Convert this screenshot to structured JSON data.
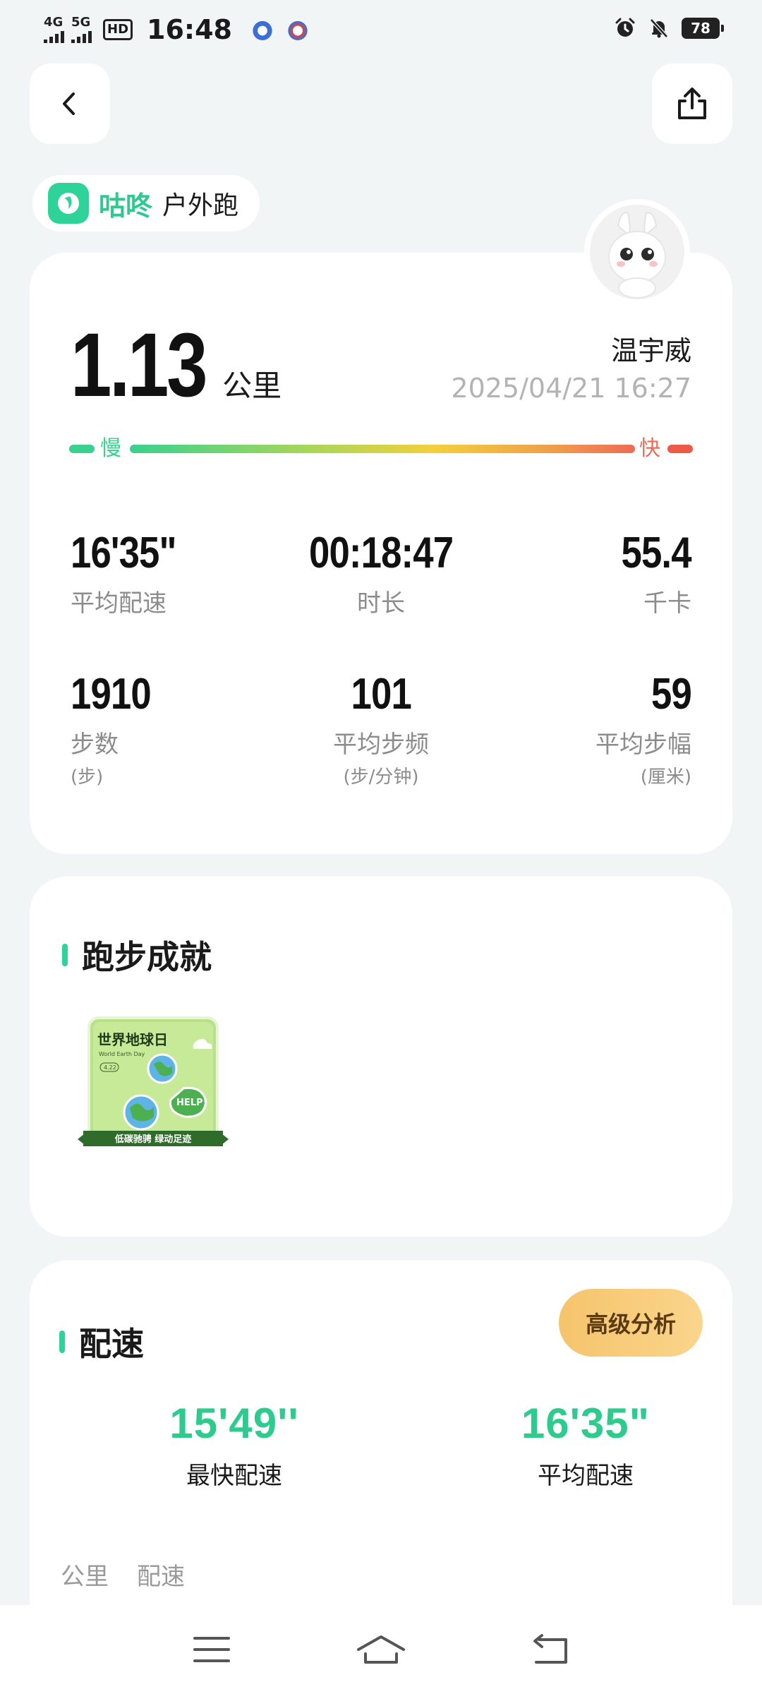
{
  "status_bar": {
    "network_1": "4G",
    "network_2": "5G",
    "hd_label": "HD",
    "time": "16:48",
    "battery": "78"
  },
  "header": {
    "back_icon": "chevron-left-icon",
    "share_icon": "share-icon"
  },
  "app_tag": {
    "brand": "咕咚",
    "sport": "户外跑"
  },
  "summary": {
    "distance": "1.13",
    "distance_unit": "公里",
    "user_name": "温宇威",
    "datetime": "2025/04/21 16:27",
    "speed_scale": {
      "slow": "慢",
      "fast": "快"
    },
    "stats": [
      {
        "value": "16'35\"",
        "label": "平均配速",
        "unit": ""
      },
      {
        "value": "00:18:47",
        "label": "时长",
        "unit": ""
      },
      {
        "value": "55.4",
        "label": "千卡",
        "unit": ""
      },
      {
        "value": "1910",
        "label": "步数",
        "unit": "(步)"
      },
      {
        "value": "101",
        "label": "平均步频",
        "unit": "(步/分钟)"
      },
      {
        "value": "59",
        "label": "平均步幅",
        "unit": "(厘米)"
      }
    ]
  },
  "achievements": {
    "title": "跑步成就",
    "badge": {
      "title": "世界地球日",
      "subtitle": "World Earth Day",
      "date": "4.22",
      "ribbon": "低碳驰骋   绿动足迹",
      "help": "HELP!"
    }
  },
  "pace": {
    "title": "配速",
    "advanced_button": "高级分析",
    "fastest_value": "15'49''",
    "fastest_label": "最快配速",
    "average_value": "16'35\"",
    "average_label": "平均配速",
    "table_headers": [
      "公里",
      "配速"
    ]
  },
  "colors": {
    "accent_green": "#2ed39a",
    "fast_red": "#ee5a48",
    "gold_button": "#f5c46c"
  }
}
